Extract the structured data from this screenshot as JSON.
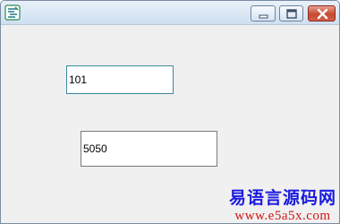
{
  "window": {
    "title": "",
    "icon": "app-logo-icon",
    "buttons": {
      "minimize": "minimize-icon",
      "maximize": "maximize-icon",
      "close": "close-icon"
    }
  },
  "fields": [
    {
      "value": "101"
    },
    {
      "value": "5050"
    }
  ],
  "watermark": {
    "title": "易语言源码网",
    "url": "www.e5a5x.com"
  },
  "colors": {
    "close_button": "#c44b30",
    "watermark_title": "#1a1ae0",
    "watermark_url": "#d21414"
  }
}
